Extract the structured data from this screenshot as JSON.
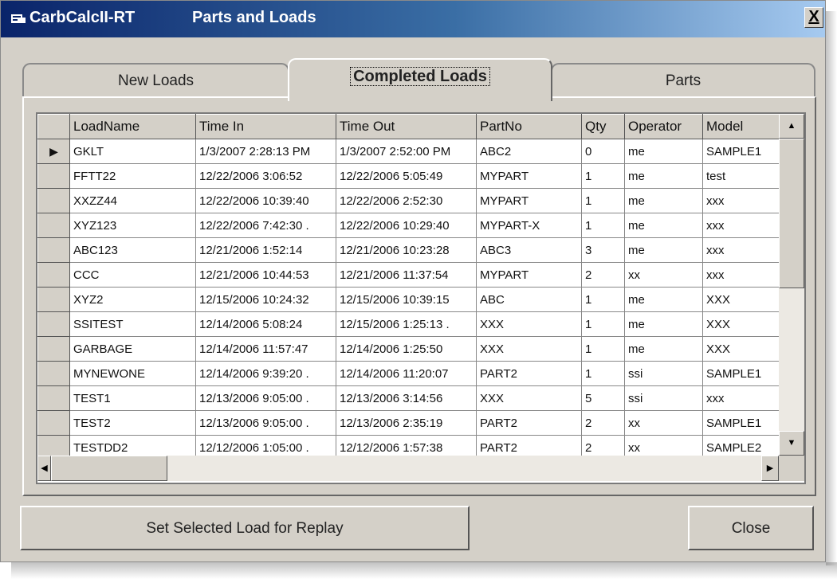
{
  "window": {
    "app_name": "CarbCalcII-RT",
    "title": "Parts and Loads",
    "close_label": "X"
  },
  "tabs": [
    {
      "label": "New Loads"
    },
    {
      "label": "Completed Loads"
    },
    {
      "label": "Parts"
    }
  ],
  "active_tab": "Completed Loads",
  "grid": {
    "columns": [
      "LoadName",
      "Time In",
      "Time Out",
      "PartNo",
      "Qty",
      "Operator",
      "Model"
    ],
    "rows": [
      [
        "GKLT",
        "1/3/2007 2:28:13 PM",
        "1/3/2007 2:52:00 PM",
        "ABC2",
        "0",
        "me",
        "SAMPLE1"
      ],
      [
        "FFTT22",
        "12/22/2006 3:06:52",
        "12/22/2006 5:05:49",
        "MYPART",
        "1",
        "me",
        "test"
      ],
      [
        "XXZZ44",
        "12/22/2006 10:39:40",
        "12/22/2006 2:52:30",
        "MYPART",
        "1",
        "me",
        "xxx"
      ],
      [
        "XYZ123",
        "12/22/2006 7:42:30 .",
        "12/22/2006 10:29:40",
        "MYPART-X",
        "1",
        "me",
        "xxx"
      ],
      [
        "ABC123",
        "12/21/2006 1:52:14",
        "12/21/2006 10:23:28",
        "ABC3",
        "3",
        "me",
        "xxx"
      ],
      [
        "CCC",
        "12/21/2006 10:44:53",
        "12/21/2006 11:37:54",
        "MYPART",
        "2",
        "xx",
        "xxx"
      ],
      [
        "XYZ2",
        "12/15/2006 10:24:32",
        "12/15/2006 10:39:15",
        "ABC",
        "1",
        "me",
        "XXX"
      ],
      [
        "SSITEST",
        "12/14/2006 5:08:24",
        "12/15/2006 1:25:13 .",
        "XXX",
        "1",
        "me",
        "XXX"
      ],
      [
        "GARBAGE",
        "12/14/2006 11:57:47",
        "12/14/2006 1:25:50",
        "XXX",
        "1",
        "me",
        "XXX"
      ],
      [
        "MYNEWONE",
        "12/14/2006 9:39:20 .",
        "12/14/2006 11:20:07",
        "PART2",
        "1",
        "ssi",
        "SAMPLE1"
      ],
      [
        "TEST1",
        "12/13/2006 9:05:00 .",
        "12/13/2006 3:14:56",
        "XXX",
        "5",
        "ssi",
        "xxx"
      ],
      [
        "TEST2",
        "12/13/2006 9:05:00 .",
        "12/13/2006 2:35:19",
        "PART2",
        "2",
        "xx",
        "SAMPLE1"
      ],
      [
        "TESTDD2",
        "12/12/2006 1:05:00 .",
        "12/12/2006 1:57:38",
        "PART2",
        "2",
        "xx",
        "SAMPLE2"
      ]
    ],
    "selected_row": 0
  },
  "buttons": {
    "replay_label": "Set Selected Load for Replay",
    "close_label": "Close"
  },
  "colors": {
    "titlebar_start": "#0a246a",
    "titlebar_end": "#a6caf0",
    "face": "#d4d0c8"
  }
}
